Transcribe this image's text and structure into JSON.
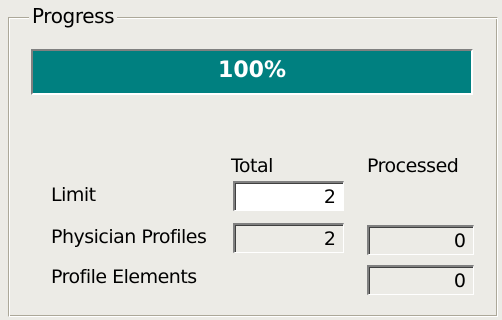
{
  "group": {
    "title": "Progress"
  },
  "progress": {
    "percent": 100,
    "text": "100%"
  },
  "columns": {
    "total": "Total",
    "processed": "Processed"
  },
  "rows": [
    {
      "label": "Limit",
      "total": "2"
    },
    {
      "label": "Physician Profiles",
      "total": "2",
      "processed": "0"
    },
    {
      "label": "Profile Elements",
      "processed": "0"
    }
  ],
  "colors": {
    "progress_fill": "#008080",
    "panel_bg": "#ecebe6"
  }
}
